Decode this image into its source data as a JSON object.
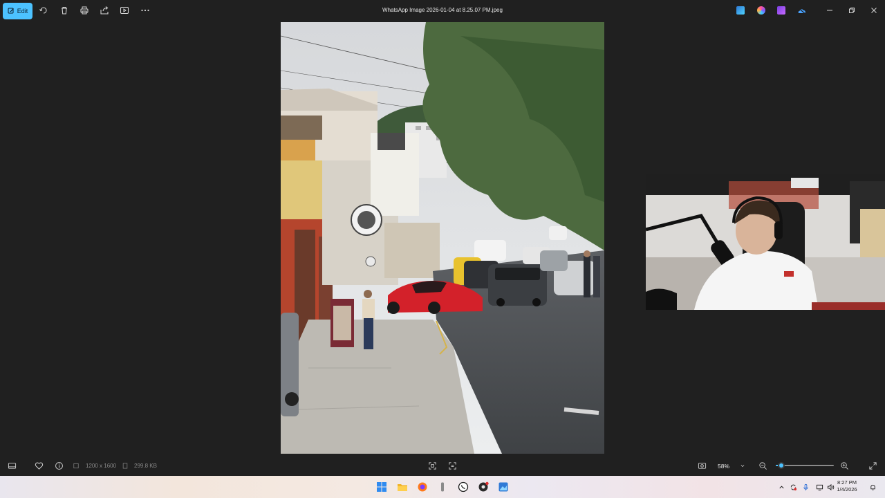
{
  "toolbar": {
    "edit_label": "Edit",
    "icons": [
      "edit-icon",
      "rotate-icon",
      "delete-icon",
      "print-icon",
      "share-icon",
      "slideshow-icon",
      "more-icon"
    ]
  },
  "window": {
    "title": "WhatsApp Image 2026-01-04 at 8.25.07 PM.jpeg",
    "controls": [
      "minimize-icon",
      "restore-icon",
      "close-icon"
    ],
    "tray_apps": [
      "photo-editor-icon",
      "copilot-icon",
      "clipchamp-icon",
      "onedrive-icon"
    ]
  },
  "status": {
    "dimensions": "1200 x 1600",
    "file_size": "299.8 KB",
    "zoom_level": "58%",
    "zoom_fraction": 0.1
  },
  "taskbar": {
    "apps": [
      "windows-start-icon",
      "file-explorer-icon",
      "firefox-icon",
      "microphone-app-icon",
      "whatsapp-icon",
      "obs-icon",
      "photos-icon"
    ],
    "time": "8:27 PM",
    "date": "1/4/2026"
  },
  "colors": {
    "accent": "#4cc2ff",
    "background": "#202020",
    "car": "#d3212a"
  }
}
